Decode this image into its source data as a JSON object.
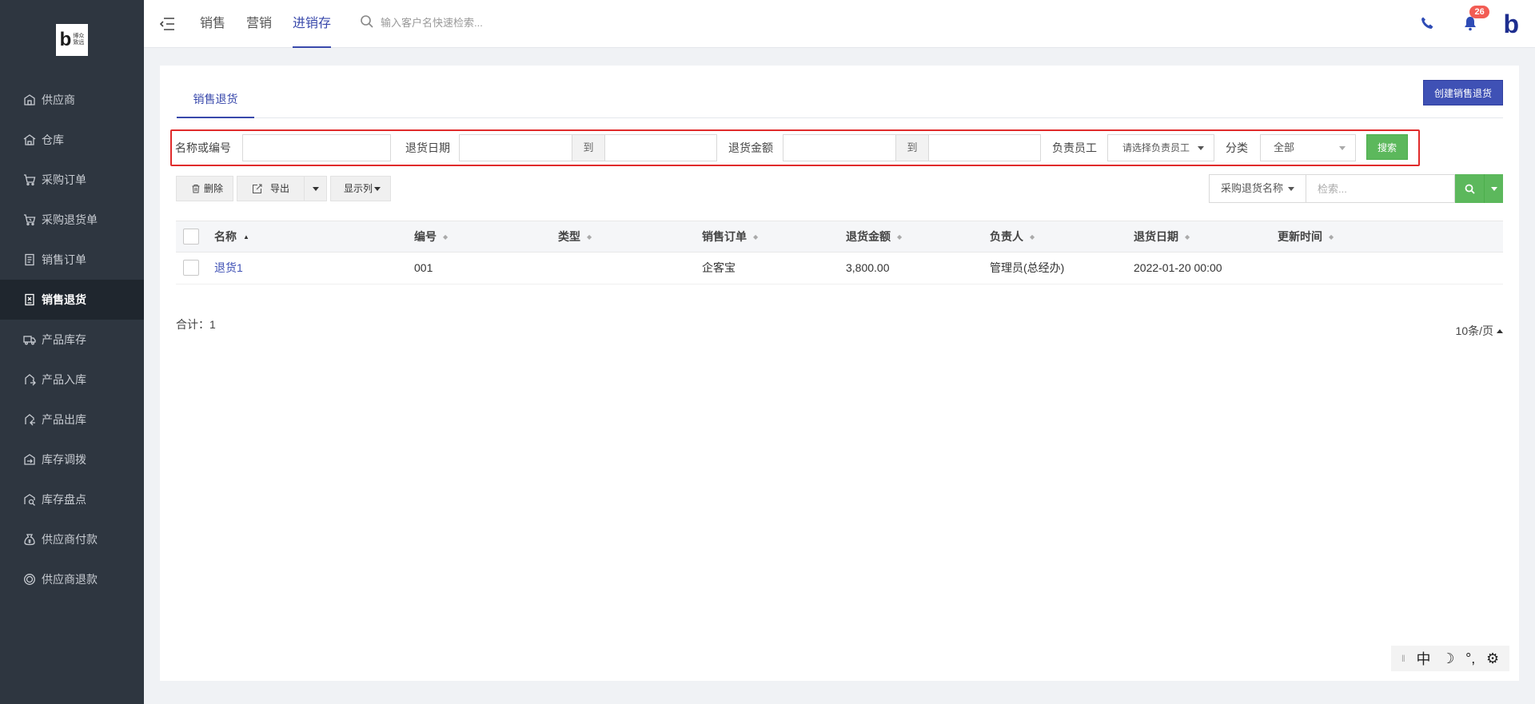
{
  "sidebar": {
    "logo_text": "博众\n致远",
    "items": [
      {
        "label": "供应商",
        "icon": "supplier-icon"
      },
      {
        "label": "仓库",
        "icon": "warehouse-icon"
      },
      {
        "label": "采购订单",
        "icon": "cart-icon"
      },
      {
        "label": "采购退货单",
        "icon": "cart-return-icon"
      },
      {
        "label": "销售订单",
        "icon": "document-icon"
      },
      {
        "label": "销售退货",
        "icon": "return-doc-icon",
        "active": true
      },
      {
        "label": "产品库存",
        "icon": "truck-icon"
      },
      {
        "label": "产品入库",
        "icon": "inbound-icon"
      },
      {
        "label": "产品出库",
        "icon": "outbound-icon"
      },
      {
        "label": "库存调拨",
        "icon": "transfer-icon"
      },
      {
        "label": "库存盘点",
        "icon": "inventory-check-icon"
      },
      {
        "label": "供应商付款",
        "icon": "money-bag-icon"
      },
      {
        "label": "供应商退款",
        "icon": "refund-icon"
      }
    ]
  },
  "topbar": {
    "nav": [
      "销售",
      "营销",
      "进销存"
    ],
    "active_nav": 2,
    "search_placeholder": "输入客户名快速检索...",
    "notification_count": "26",
    "brand": "b"
  },
  "panel": {
    "tab_label": "销售退货",
    "create_button": "创建销售退货"
  },
  "filters": {
    "name_label": "名称或编号",
    "date_label": "退货日期",
    "to_label": "到",
    "amount_label": "退货金额",
    "staff_label": "负责员工",
    "staff_placeholder": "请选择负责员工",
    "category_label": "分类",
    "category_value": "全部",
    "search_button": "搜索"
  },
  "toolbar": {
    "delete": "删除",
    "export": "导出",
    "columns": "显示列",
    "search_field": "采购退货名称",
    "search_placeholder": "检索..."
  },
  "table": {
    "headers": [
      "名称",
      "编号",
      "类型",
      "销售订单",
      "退货金额",
      "负责人",
      "退货日期",
      "更新时间"
    ],
    "rows": [
      {
        "name": "退货1",
        "code": "001",
        "type": "",
        "order": "企客宝",
        "amount": "3,800.00",
        "owner": "管理员(总经办)",
        "date": "2022-01-20 00:00",
        "updated": ""
      }
    ]
  },
  "footer": {
    "total": "合计：1",
    "per_page": "10条/页"
  },
  "ime": [
    "中",
    "☽",
    "°,",
    "⚙"
  ],
  "colors": {
    "sidebar_bg": "#2e3640",
    "primary": "#3f51b5",
    "success": "#5cb85c",
    "highlight_border": "#e02b2b",
    "badge": "#f25c54"
  }
}
